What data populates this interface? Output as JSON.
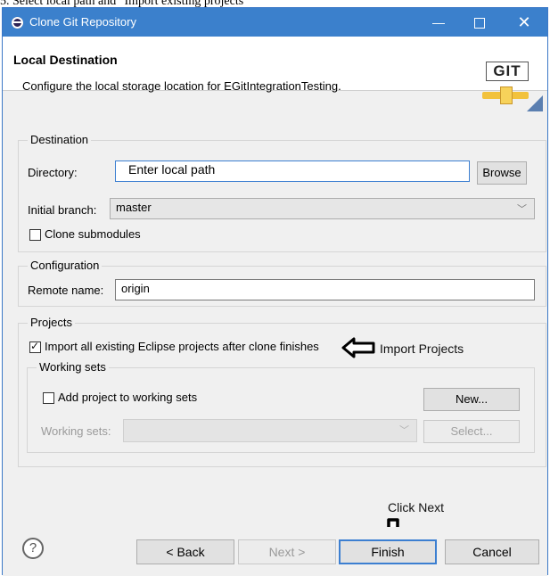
{
  "caption": "5. Select local path and \"Import existing projects\"",
  "window": {
    "title": "Clone Git Repository",
    "minimize_glyph": "—",
    "close_glyph": "✕"
  },
  "banner": {
    "heading": "Local Destination",
    "description": "Configure the local storage location for EGitIntegrationTesting.",
    "logo_text": "GIT"
  },
  "destination": {
    "group_label": "Destination",
    "directory_label": "Directory:",
    "directory_value": "Enter local path",
    "browse_label": "Browse",
    "branch_label": "Initial branch:",
    "branch_value": "master",
    "clone_submodules_label": "Clone submodules",
    "clone_submodules_checked": false
  },
  "configuration": {
    "group_label": "Configuration",
    "remote_label": "Remote name:",
    "remote_value": "origin"
  },
  "projects": {
    "group_label": "Projects",
    "import_label": "Import all existing Eclipse projects after clone finishes",
    "import_checked": true,
    "working_sets": {
      "group_label": "Working sets",
      "add_label": "Add project to working sets",
      "add_checked": false,
      "new_label": "New...",
      "sets_label": "Working sets:",
      "sets_value": "",
      "select_label": "Select..."
    }
  },
  "annotations": {
    "import_projects": "Import Projects",
    "click_next": "Click Next"
  },
  "buttons": {
    "help": "?",
    "back": "< Back",
    "next": "Next >",
    "finish": "Finish",
    "cancel": "Cancel"
  },
  "icons": {
    "app": "eclipse-icon",
    "help": "help-icon",
    "chevron": "chevron-down-icon"
  },
  "colors": {
    "titlebar": "#3b80cc",
    "focus": "#3c7fd1"
  }
}
